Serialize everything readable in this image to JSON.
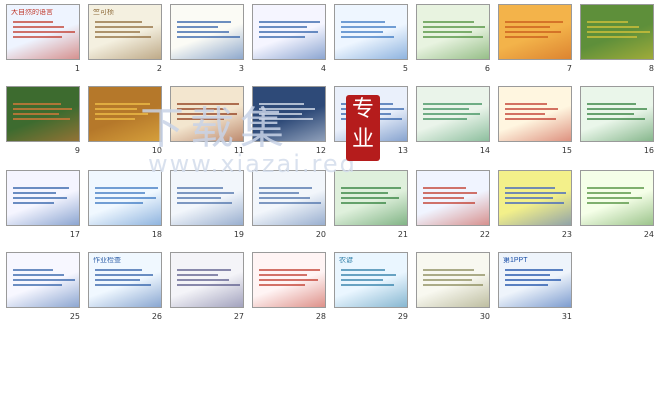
{
  "slides": [
    {
      "n": "1",
      "title": "大自然的语言",
      "bg": "#eef4ff",
      "accent": "#c0392b"
    },
    {
      "n": "2",
      "title": "竺可桢",
      "bg": "#f4f0e0",
      "accent": "#8e6b3a"
    },
    {
      "n": "3",
      "title": "",
      "bg": "#fbfbf5",
      "accent": "#2f5fa8"
    },
    {
      "n": "4",
      "title": "",
      "bg": "#f5f5ff",
      "accent": "#2f5fa8"
    },
    {
      "n": "5",
      "title": "",
      "bg": "#eef6ff",
      "accent": "#3a78c2"
    },
    {
      "n": "6",
      "title": "",
      "bg": "#e8f3e0",
      "accent": "#4d8f3a"
    },
    {
      "n": "7",
      "title": "",
      "bg": "#f3b34a",
      "accent": "#c85a1a"
    },
    {
      "n": "8",
      "title": "",
      "bg": "#5e8f3a",
      "accent": "#d9c43a"
    },
    {
      "n": "9",
      "title": "",
      "bg": "#3d6b2f",
      "accent": "#e07a3a"
    },
    {
      "n": "10",
      "title": "",
      "bg": "#b5782a",
      "accent": "#f2c24a"
    },
    {
      "n": "11",
      "title": "",
      "bg": "#f3e6cf",
      "accent": "#8e3a1a"
    },
    {
      "n": "12",
      "title": "",
      "bg": "#2e4a78",
      "accent": "#e8eef6"
    },
    {
      "n": "13",
      "title": "",
      "bg": "#eaf0fb",
      "accent": "#2f5fa8"
    },
    {
      "n": "14",
      "title": "",
      "bg": "#eaf4ea",
      "accent": "#3a8f5a"
    },
    {
      "n": "15",
      "title": "",
      "bg": "#fff6e0",
      "accent": "#c0392b"
    },
    {
      "n": "16",
      "title": "",
      "bg": "#eaf6ea",
      "accent": "#2f7f3a"
    },
    {
      "n": "17",
      "title": "",
      "bg": "#f5f5ff",
      "accent": "#2f5fa8"
    },
    {
      "n": "18",
      "title": "",
      "bg": "#f0f8ff",
      "accent": "#3a78c2"
    },
    {
      "n": "19",
      "title": "",
      "bg": "#f2f6fb",
      "accent": "#4a6fa8"
    },
    {
      "n": "20",
      "title": "",
      "bg": "#f2f6fb",
      "accent": "#4a6fa8"
    },
    {
      "n": "21",
      "title": "",
      "bg": "#dff0dc",
      "accent": "#2f7f3a"
    },
    {
      "n": "22",
      "title": "",
      "bg": "#f0f4ff",
      "accent": "#c0392b"
    },
    {
      "n": "23",
      "title": "",
      "bg": "#f3f08a",
      "accent": "#3a5fc2"
    },
    {
      "n": "24",
      "title": "",
      "bg": "#f5ffe8",
      "accent": "#4d8f3a"
    },
    {
      "n": "25",
      "title": "",
      "bg": "#f7f7ff",
      "accent": "#2f5fa8"
    },
    {
      "n": "26",
      "title": "作业检查",
      "bg": "#f0f8ff",
      "accent": "#2f5fa8"
    },
    {
      "n": "27",
      "title": "",
      "bg": "#f4f4f8",
      "accent": "#5a5a8a"
    },
    {
      "n": "28",
      "title": "",
      "bg": "#fff4f4",
      "accent": "#c0392b"
    },
    {
      "n": "29",
      "title": "农谚",
      "bg": "#eaf6ff",
      "accent": "#2f7fa8"
    },
    {
      "n": "30",
      "title": "",
      "bg": "#f8f8f0",
      "accent": "#8a8a5a"
    },
    {
      "n": "31",
      "title": "第1PPT",
      "bg": "#eef4fb",
      "accent": "#1a4fa8"
    }
  ],
  "watermark": {
    "text": "下载集",
    "url": "www.xiazai.red",
    "badge": "专业"
  }
}
